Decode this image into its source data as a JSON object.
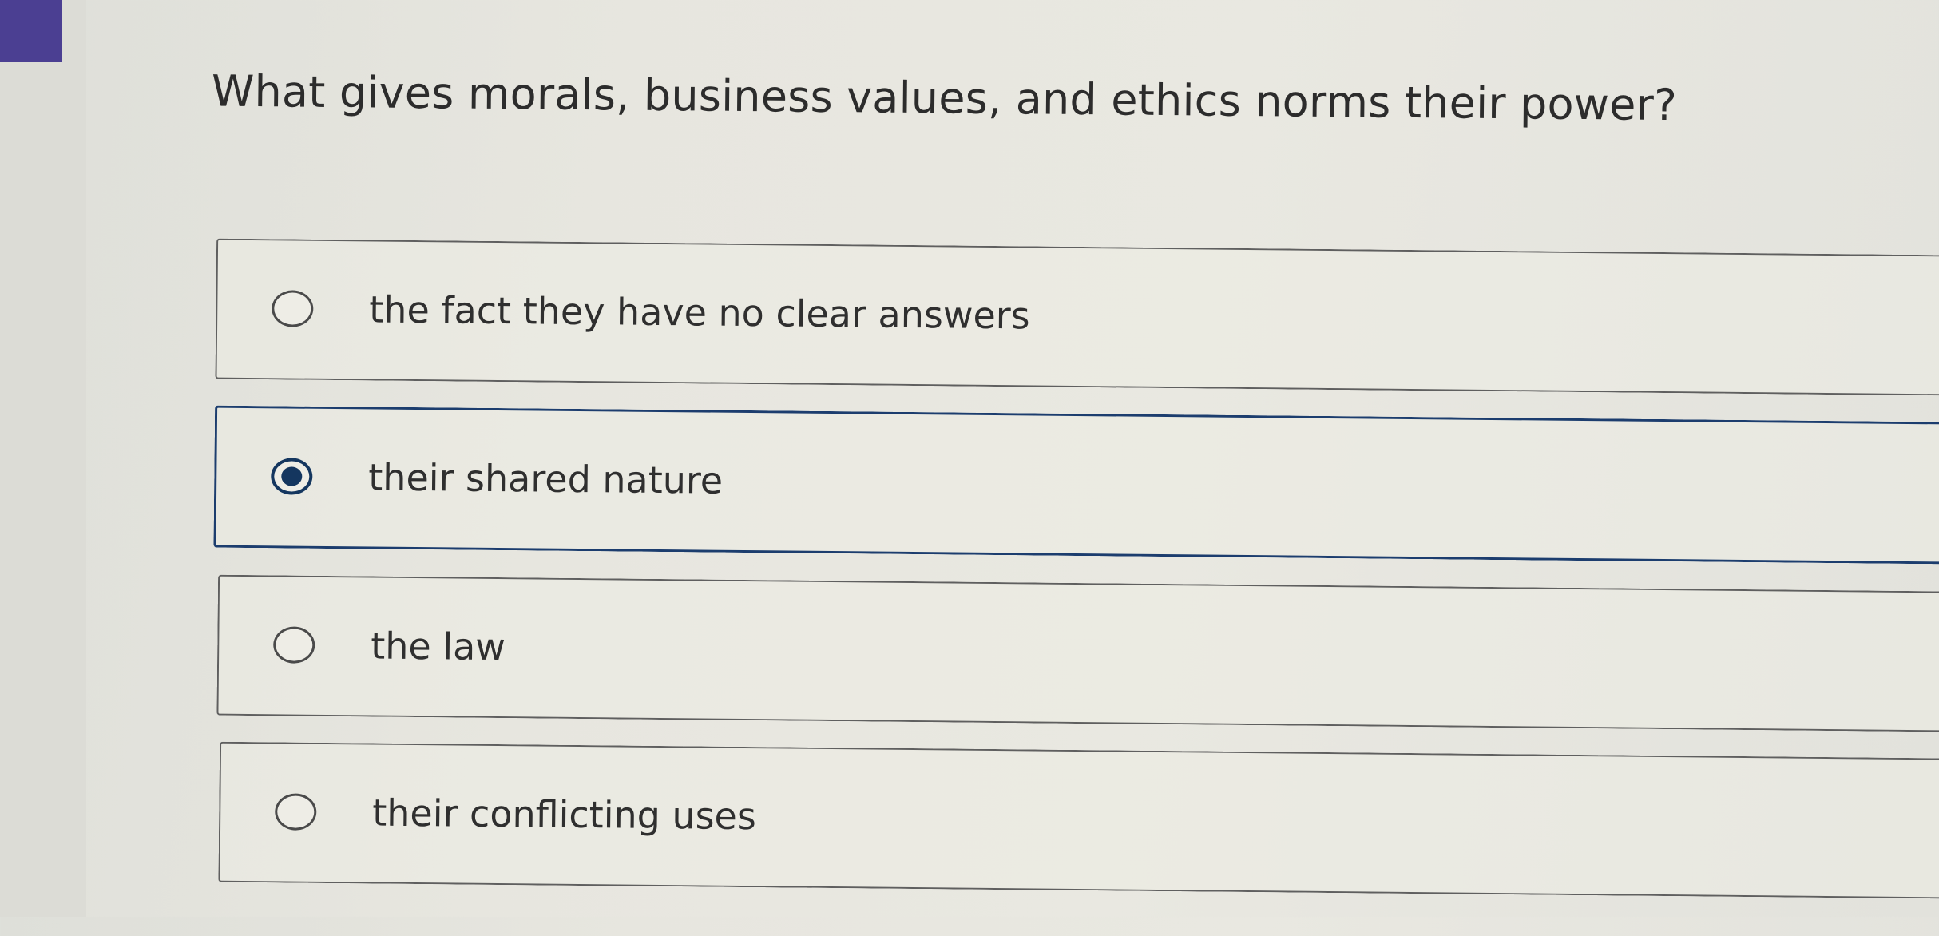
{
  "question": {
    "text": "What gives morals, business values, and ethics norms their power?"
  },
  "choices": [
    {
      "label": "the fact they have no clear answers",
      "selected": false
    },
    {
      "label": "their shared nature",
      "selected": true
    },
    {
      "label": "the law",
      "selected": false
    },
    {
      "label": "their conflicting uses",
      "selected": false
    }
  ],
  "colors": {
    "accent": "#4b3f92",
    "selected": "#14365f",
    "background": "#e8e7e0"
  }
}
